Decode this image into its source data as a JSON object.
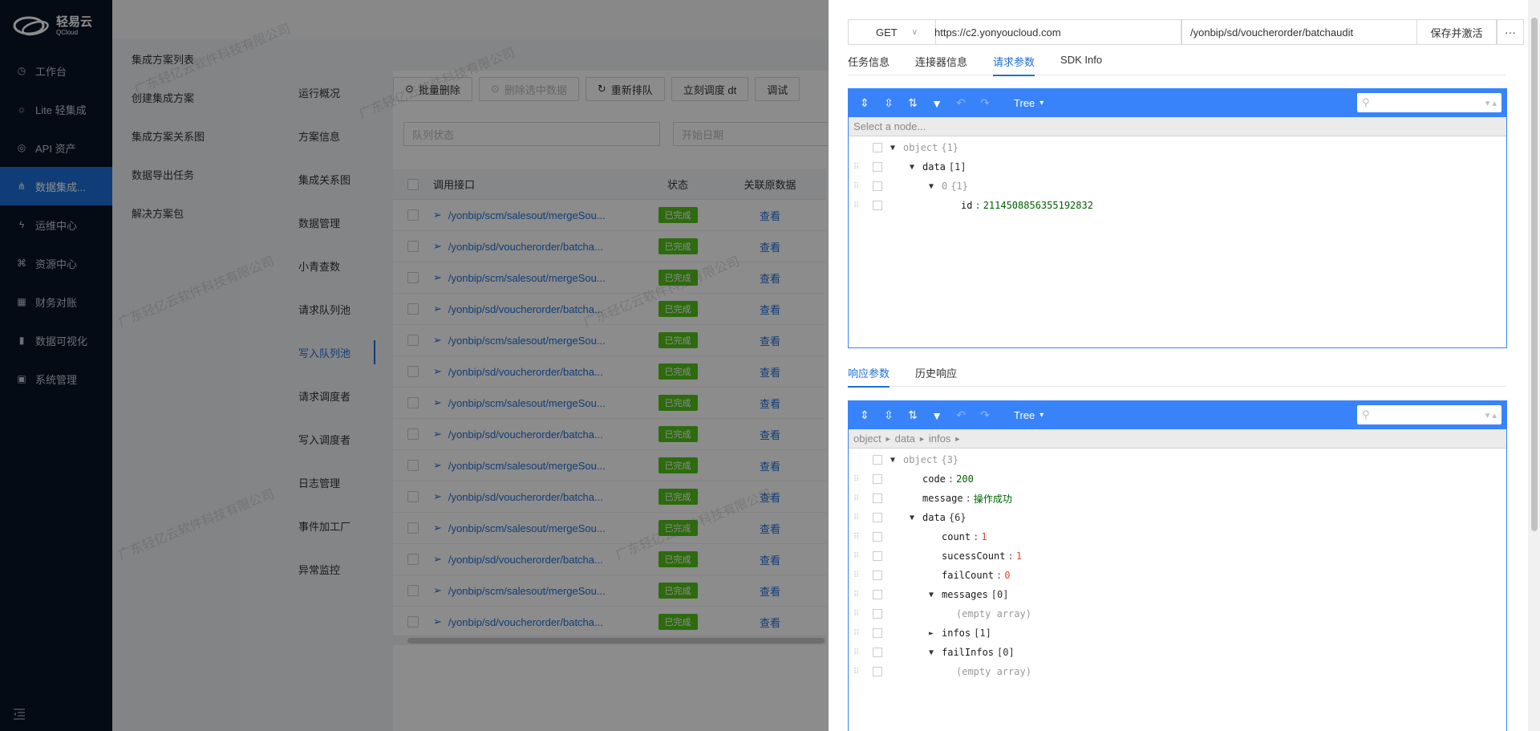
{
  "brand": {
    "name_cn": "轻易云",
    "name_en": "QCloud"
  },
  "sidebar": {
    "items": [
      {
        "label": "工作台",
        "icon": "clock-icon"
      },
      {
        "label": "Lite 轻集成",
        "icon": "bulb-icon"
      },
      {
        "label": "API 资产",
        "icon": "compass-icon"
      },
      {
        "label": "数据集成...",
        "icon": "share-icon",
        "active": true
      },
      {
        "label": "运维中心",
        "icon": "bolt-icon"
      },
      {
        "label": "资源中心",
        "icon": "cluster-icon"
      },
      {
        "label": "财务对账",
        "icon": "calculator-icon"
      },
      {
        "label": "数据可视化",
        "icon": "bar-chart-icon"
      },
      {
        "label": "系统管理",
        "icon": "apps-icon"
      }
    ]
  },
  "submenu": {
    "items": [
      "集成方案列表",
      "创建集成方案",
      "集成方案关系图",
      "数据导出任务",
      "解决方案包"
    ]
  },
  "detail_tabs": {
    "items": [
      "运行概况",
      "方案信息",
      "集成关系图",
      "数据管理",
      "小青查数",
      "请求队列池",
      "写入队列池",
      "请求调度者",
      "写入调度者",
      "日志管理",
      "事件加工厂",
      "异常监控"
    ],
    "active": "写入队列池"
  },
  "toolbar": {
    "batch_delete": "批量删除",
    "delete_selected": "删除选中数据",
    "requeue": "重新排队",
    "dispatch_now": "立刻调度 dt",
    "debug": "调试"
  },
  "filters": {
    "queue_status": "队列状态",
    "start_date": "开始日期"
  },
  "table": {
    "headers": {
      "api": "调用接口",
      "status": "状态",
      "related": "关联原数据"
    },
    "rows": [
      {
        "api": "/yonbip/scm/salesout/mergeSou...",
        "status": "已完成",
        "link": "查看"
      },
      {
        "api": "/yonbip/sd/voucherorder/batcha...",
        "status": "已完成",
        "link": "查看"
      },
      {
        "api": "/yonbip/scm/salesout/mergeSou...",
        "status": "已完成",
        "link": "查看"
      },
      {
        "api": "/yonbip/sd/voucherorder/batcha...",
        "status": "已完成",
        "link": "查看"
      },
      {
        "api": "/yonbip/scm/salesout/mergeSou...",
        "status": "已完成",
        "link": "查看"
      },
      {
        "api": "/yonbip/sd/voucherorder/batcha...",
        "status": "已完成",
        "link": "查看"
      },
      {
        "api": "/yonbip/scm/salesout/mergeSou...",
        "status": "已完成",
        "link": "查看"
      },
      {
        "api": "/yonbip/sd/voucherorder/batcha...",
        "status": "已完成",
        "link": "查看"
      },
      {
        "api": "/yonbip/scm/salesout/mergeSou...",
        "status": "已完成",
        "link": "查看"
      },
      {
        "api": "/yonbip/sd/voucherorder/batcha...",
        "status": "已完成",
        "link": "查看"
      },
      {
        "api": "/yonbip/scm/salesout/mergeSou...",
        "status": "已完成",
        "link": "查看"
      },
      {
        "api": "/yonbip/sd/voucherorder/batcha...",
        "status": "已完成",
        "link": "查看"
      },
      {
        "api": "/yonbip/scm/salesout/mergeSou...",
        "status": "已完成",
        "link": "查看"
      },
      {
        "api": "/yonbip/sd/voucherorder/batcha...",
        "status": "已完成",
        "link": "查看"
      }
    ]
  },
  "watermark": "广东轻亿云软件科技有限公司",
  "drawer": {
    "method": "GET",
    "host": "https://c2.yonyoucloud.com",
    "path": "/yonbip/sd/voucherorder/batchaudit",
    "save_label": "保存并激活",
    "more_label": "···",
    "tabs": [
      "任务信息",
      "连接器信息",
      "请求参数",
      "SDK Info"
    ],
    "active_tab": "请求参数",
    "response_tabs": [
      "响应参数",
      "历史响应"
    ],
    "active_response_tab": "响应参数",
    "editor_mode": "Tree",
    "request_editor": {
      "nav_placeholder": "Select a node...",
      "nodes": [
        {
          "key": "object",
          "count": "{1}",
          "toggle": "▼",
          "depth": 0,
          "root": true
        },
        {
          "key": "data",
          "count": "[1]",
          "toggle": "▼",
          "depth": 1
        },
        {
          "key": "0",
          "count": "{1}",
          "toggle": "▼",
          "depth": 2,
          "index": true
        },
        {
          "key": "id",
          "value": "2114508856355192832",
          "vtype": "str",
          "depth": 3
        }
      ]
    },
    "response_editor": {
      "breadcrumb": [
        "object",
        "data",
        "infos"
      ],
      "nodes": [
        {
          "key": "object",
          "count": "{3}",
          "toggle": "▼",
          "depth": 0,
          "root": true
        },
        {
          "key": "code",
          "value": "200",
          "vtype": "str",
          "depth": 1
        },
        {
          "key": "message",
          "value": "操作成功",
          "vtype": "str",
          "depth": 1
        },
        {
          "key": "data",
          "count": "{6}",
          "toggle": "▼",
          "depth": 1
        },
        {
          "key": "count",
          "value": "1",
          "vtype": "num",
          "depth": 2
        },
        {
          "key": "sucessCount",
          "value": "1",
          "vtype": "num",
          "depth": 2
        },
        {
          "key": "failCount",
          "value": "0",
          "vtype": "num",
          "depth": 2
        },
        {
          "key": "messages",
          "count": "[0]",
          "toggle": "▼",
          "depth": 2
        },
        {
          "note": "(empty array)",
          "depth": 3
        },
        {
          "key": "infos",
          "count": "[1]",
          "toggle": "►",
          "depth": 2
        },
        {
          "key": "failInfos",
          "count": "[0]",
          "toggle": "▼",
          "depth": 2
        },
        {
          "note": "(empty array)",
          "depth": 3
        }
      ]
    }
  },
  "colors": {
    "accent": "#1e6fd9",
    "editor_blue": "#3883fa",
    "success": "#52c41a",
    "sidebar_bg": "#081427"
  }
}
